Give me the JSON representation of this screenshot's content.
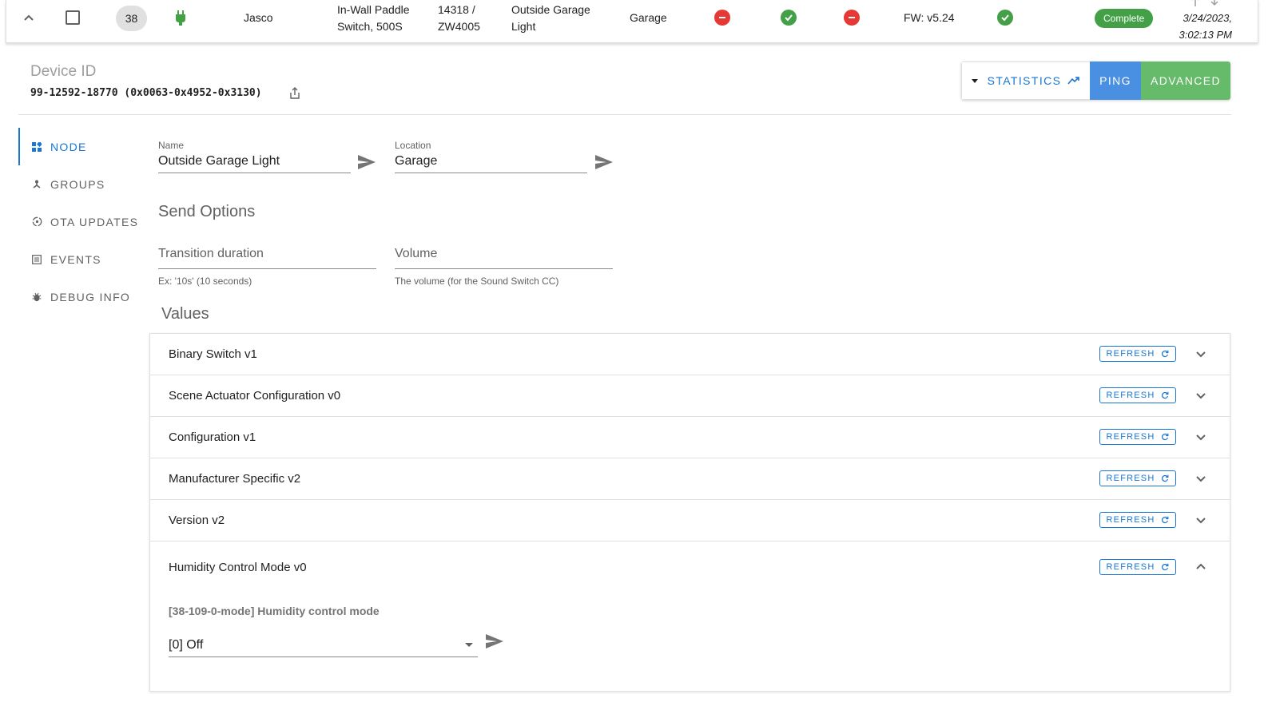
{
  "row": {
    "node_id": "38",
    "manufacturer": "Jasco",
    "product": "In-Wall Paddle Switch, 500S",
    "product_code": "14318 / ZW4005",
    "name": "Outside Garage Light",
    "location": "Garage",
    "firmware": "FW: v5.24",
    "interview_status": "Complete",
    "last_active": "3/24/2023, 3:02:13 PM",
    "status_colors": {
      "red": "#e53935",
      "green": "#43a047"
    }
  },
  "device": {
    "id_label": "Device ID",
    "id_value": "99-12592-18770 (0x0063-0x4952-0x3130)"
  },
  "actions": {
    "statistics": "STATISTICS",
    "ping": "PING",
    "advanced": "ADVANCED"
  },
  "tabs": [
    {
      "label": "NODE",
      "icon": "grid-icon"
    },
    {
      "label": "GROUPS",
      "icon": "tree-icon"
    },
    {
      "label": "OTA UPDATES",
      "icon": "update-icon"
    },
    {
      "label": "EVENTS",
      "icon": "list-icon"
    },
    {
      "label": "DEBUG INFO",
      "icon": "bug-icon"
    }
  ],
  "node_form": {
    "name_label": "Name",
    "name_value": "Outside Garage Light",
    "location_label": "Location",
    "location_value": "Garage",
    "send_options_title": "Send Options",
    "transition_placeholder": "Transition duration",
    "transition_hint": "Ex: '10s' (10 seconds)",
    "volume_placeholder": "Volume",
    "volume_hint": "The volume (for the Sound Switch CC)"
  },
  "values": {
    "title": "Values",
    "refresh_label": "REFRESH",
    "items": [
      {
        "title": "Binary Switch v1"
      },
      {
        "title": "Scene Actuator Configuration v0"
      },
      {
        "title": "Configuration v1"
      },
      {
        "title": "Manufacturer Specific v2"
      },
      {
        "title": "Version v2"
      },
      {
        "title": "Humidity Control Mode v0"
      }
    ],
    "expanded": {
      "field_label": "[38-109-0-mode] Humidity control mode",
      "selected": "[0] Off"
    }
  }
}
